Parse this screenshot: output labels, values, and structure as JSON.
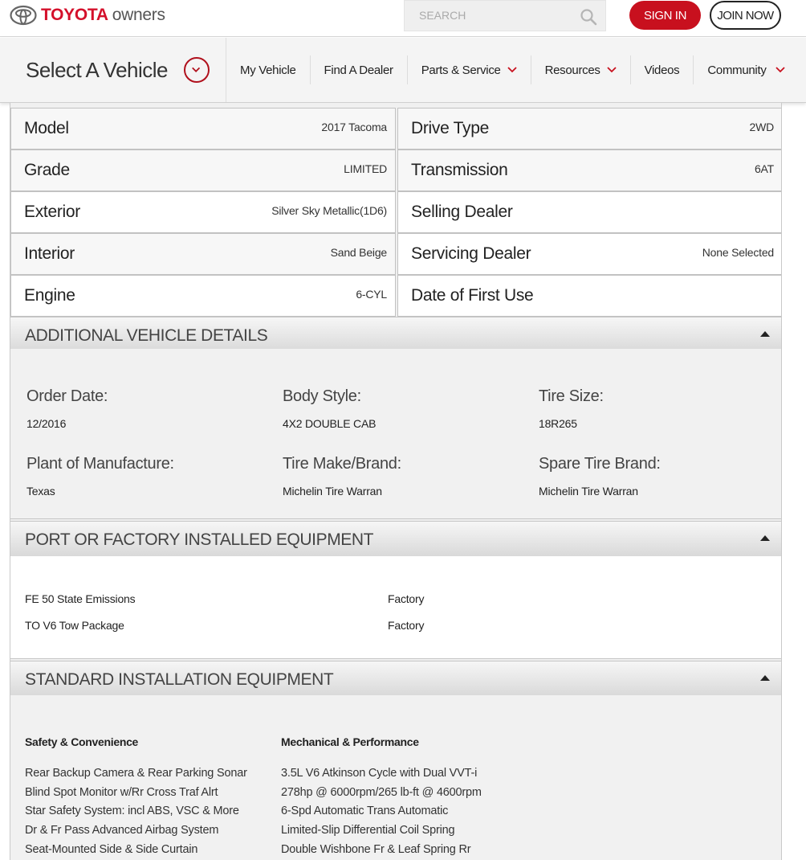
{
  "header": {
    "brand": "TOYOTA",
    "brand_sub": "owners",
    "search_placeholder": "SEARCH",
    "signin_label": "SIGN IN",
    "join_label": "JOIN NOW",
    "accent": "#c8101e"
  },
  "nav": {
    "select_vehicle": "Select A Vehicle",
    "items": [
      {
        "label": "My Vehicle",
        "dropdown": false
      },
      {
        "label": "Find A Dealer",
        "dropdown": false
      },
      {
        "label": "Parts & Service",
        "dropdown": true
      },
      {
        "label": "Resources",
        "dropdown": true
      },
      {
        "label": "Videos",
        "dropdown": false
      },
      {
        "label": "Community",
        "dropdown": true
      }
    ]
  },
  "specs": {
    "left": [
      {
        "label": "Model",
        "value": "2017 Tacoma"
      },
      {
        "label": "Grade",
        "value": "LIMITED"
      },
      {
        "label": "Exterior",
        "value": "Silver Sky Metallic(1D6)"
      },
      {
        "label": "Interior",
        "value": "Sand Beige"
      },
      {
        "label": "Engine",
        "value": "6-CYL"
      }
    ],
    "right": [
      {
        "label": "Drive Type",
        "value": "2WD"
      },
      {
        "label": "Transmission",
        "value": "6AT"
      },
      {
        "label": "Selling Dealer",
        "value": ""
      },
      {
        "label": "Servicing Dealer",
        "value": "None Selected"
      },
      {
        "label": "Date of First Use",
        "value": ""
      }
    ]
  },
  "additional_details": {
    "title": "ADDITIONAL VEHICLE DETAILS",
    "items": [
      {
        "label": "Order Date:",
        "value": "12/2016"
      },
      {
        "label": "Body Style:",
        "value": "4X2 DOUBLE CAB"
      },
      {
        "label": "Tire Size:",
        "value": "18R265"
      },
      {
        "label": "Plant of Manufacture:",
        "value": "Texas"
      },
      {
        "label": "Tire Make/Brand:",
        "value": "Michelin Tire Warran"
      },
      {
        "label": "Spare Tire Brand:",
        "value": "Michelin Tire Warran"
      }
    ]
  },
  "installed_equipment": {
    "title": "PORT OR FACTORY INSTALLED EQUIPMENT",
    "rows": [
      {
        "code": "FE 50 State Emissions",
        "source": "Factory"
      },
      {
        "code": "TO V6 Tow Package",
        "source": "Factory"
      }
    ]
  },
  "standard_equipment": {
    "title": "STANDARD INSTALLATION EQUIPMENT",
    "columns": [
      {
        "heading": "Safety & Convenience",
        "items": [
          "Rear Backup Camera & Rear Parking Sonar",
          "Blind Spot Monitor w/Rr Cross Traf Alrt",
          "Star Safety System: incl ABS, VSC & More",
          "Dr & Fr Pass Advanced Airbag System",
          "Seat-Mounted Side & Side Curtain"
        ]
      },
      {
        "heading": "Mechanical & Performance",
        "items": [
          "3.5L V6 Atkinson Cycle with Dual VVT-i",
          "278hp @ 6000rpm/265 lb-ft @ 4600rpm",
          "6-Spd Automatic Trans Automatic",
          "Limited-Slip Differential Coil Spring",
          "Double Wishbone Fr & Leaf Spring Rr"
        ]
      }
    ]
  }
}
